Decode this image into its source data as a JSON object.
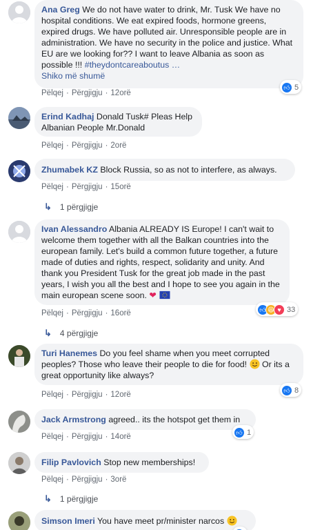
{
  "labels": {
    "like": "Pëlqej",
    "reply": "Përgjigju",
    "see_more": "Shiko më shumë",
    "dot": "·"
  },
  "comments": [
    {
      "author": "Ana Greg",
      "text": "We do not have water to drink, Mr. Tusk We have no hospital conditions. We eat expired foods, hormone greens, expired drugs. We have polluted air. Unresponsible people are in administration. We have no security in the police and justice. What EU are we looking for?? I want to leave Albania as soon as possible !!! ",
      "hashtag": "#theydontcareaboutus …",
      "time": "12orë",
      "reactions": "5"
    },
    {
      "author": "Erind Kadhaj",
      "text": "Donald Tusk# Pleas Help Albanian People Mr.Donald",
      "time": "2orë"
    },
    {
      "author": "Zhumabek KZ",
      "text": "Block Russia, so as not to interfere, as always.",
      "time": "15orë",
      "replies": "1 përgjigje"
    },
    {
      "author": "Ivan Alessandro",
      "text": "Albania ALREADY IS Europe! I can't wait to welcome them together with all the Balkan countries into the european family. Let's build a common future together, a future made of duties and rights, respect, solidarity and unity. And thank you President Tusk for the great job made in the past years, I wish you all the best and I hope to see you again in the main european scene soon.",
      "time": "16orë",
      "reactions": "33",
      "replies": "4 përgjigje"
    },
    {
      "author": "Turi Hanemes",
      "text": "Do you feel shame when you meet corrupted peoples? Those who leave their people to die for food!",
      "text_after": " Or its a great opportunity like always?",
      "time": "12orë",
      "reactions": "8"
    },
    {
      "author": "Jack Armstrong",
      "text": "agreed.. its the hotspot get them in",
      "time": "14orë",
      "reactions": "1"
    },
    {
      "author": "Filip Pavlovich",
      "text": "Stop new memberships!",
      "time": "3orë",
      "replies": "1 përgjigje"
    },
    {
      "author": "Simson Imeri",
      "text": "You have meet pr/minister narcos"
    }
  ],
  "colors": {
    "link": "#385898",
    "bubble": "#f2f3f5",
    "meta": "#606770",
    "like": "#1877f2",
    "love": "#f33e58",
    "haha": "#f7b125"
  },
  "icons": [
    "like-icon",
    "haha-icon",
    "love-icon",
    "heart-icon",
    "eu-flag-icon",
    "smile-icon",
    "reply-arrow-icon"
  ]
}
